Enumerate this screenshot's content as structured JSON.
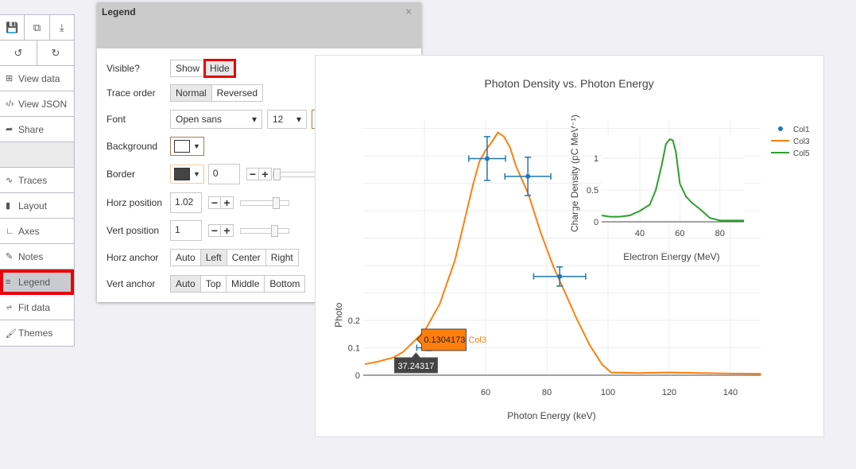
{
  "sidebar": {
    "toolbar_top": [
      {
        "icon": "save-icon",
        "glyph": "💾"
      },
      {
        "icon": "copy-icon",
        "glyph": "⧉"
      },
      {
        "icon": "download-icon",
        "glyph": "⤓"
      }
    ],
    "toolbar_undo": [
      {
        "icon": "undo-icon",
        "glyph": "↺"
      },
      {
        "icon": "redo-icon",
        "glyph": "↻"
      }
    ],
    "items": [
      {
        "label": "View data",
        "icon": "grid-icon",
        "glyph": "⊞"
      },
      {
        "label": "View JSON",
        "icon": "code-icon",
        "glyph": "‹/›"
      },
      {
        "label": "Share",
        "icon": "share-icon",
        "glyph": "➦"
      },
      {
        "label": "",
        "icon": "",
        "glyph": ""
      },
      {
        "label": "Traces",
        "icon": "traces-icon",
        "glyph": "∿"
      },
      {
        "label": "Layout",
        "icon": "layout-icon",
        "glyph": "▮"
      },
      {
        "label": "Axes",
        "icon": "axes-icon",
        "glyph": "∟"
      },
      {
        "label": "Notes",
        "icon": "notes-icon",
        "glyph": "✎"
      },
      {
        "label": "Legend",
        "icon": "legend-icon",
        "glyph": "≡",
        "active": true
      },
      {
        "label": "Fit data",
        "icon": "fit-icon",
        "glyph": "⩫"
      },
      {
        "label": "Themes",
        "icon": "themes-icon",
        "glyph": "🖌"
      }
    ]
  },
  "panel": {
    "title": "Legend",
    "close": "×",
    "visible": {
      "label": "Visible?",
      "options": [
        "Show",
        "Hide"
      ],
      "selected": "Hide"
    },
    "trace_order": {
      "label": "Trace order",
      "options": [
        "Normal",
        "Reversed"
      ],
      "selected": "Normal"
    },
    "font": {
      "label": "Font",
      "family": "Open sans",
      "size": "12",
      "color": "#444444"
    },
    "background": {
      "label": "Background",
      "color": "#ffffff"
    },
    "border": {
      "label": "Border",
      "color": "#444444",
      "width": "0",
      "slider": 0
    },
    "horz_position": {
      "label": "Horz position",
      "value": "1.02",
      "slider": 0.78
    },
    "vert_position": {
      "label": "Vert position",
      "value": "1",
      "slider": 0.75
    },
    "horz_anchor": {
      "label": "Horz anchor",
      "options": [
        "Auto",
        "Left",
        "Center",
        "Right"
      ],
      "selected": "Left"
    },
    "vert_anchor": {
      "label": "Vert anchor",
      "options": [
        "Auto",
        "Top",
        "Middle",
        "Bottom"
      ],
      "selected": "Auto"
    }
  },
  "chart_data": {
    "type": "line",
    "title": "Photon Density vs. Photon Energy",
    "xlabel": "Photon Energy (keV)",
    "ylabel": "Photo",
    "xlim": [
      20,
      150
    ],
    "ylim": [
      0,
      0.93
    ],
    "xticks": [
      60,
      80,
      100,
      120,
      140
    ],
    "yticks": [
      0,
      0.1,
      0.2
    ],
    "grid": true,
    "legend": "top-right",
    "colors": {
      "Col1": "#1f77b4",
      "Col3": "#ff7f0e",
      "Col5": "#2ca02c"
    },
    "series": [
      {
        "name": "Col1",
        "mode": "markers",
        "points": [
          [
            41.5,
            0.1,
            4,
            0.01
          ],
          [
            60.5,
            0.79,
            6,
            0.08
          ],
          [
            73.8,
            0.725,
            7.5,
            0.07
          ],
          [
            84.2,
            0.36,
            8.5,
            0.035
          ]
        ]
      },
      {
        "name": "Col3",
        "mode": "lines",
        "points": [
          [
            20.5,
            0.04
          ],
          [
            25,
            0.05
          ],
          [
            30,
            0.065
          ],
          [
            33,
            0.085
          ],
          [
            37.2,
            0.13
          ],
          [
            40,
            0.16
          ],
          [
            45,
            0.26
          ],
          [
            50,
            0.42
          ],
          [
            53,
            0.56
          ],
          [
            56,
            0.7
          ],
          [
            58,
            0.78
          ],
          [
            60,
            0.82
          ],
          [
            62,
            0.85
          ],
          [
            64,
            0.885
          ],
          [
            66,
            0.87
          ],
          [
            68,
            0.83
          ],
          [
            70,
            0.76
          ],
          [
            74,
            0.66
          ],
          [
            78,
            0.52
          ],
          [
            82,
            0.4
          ],
          [
            86,
            0.3
          ],
          [
            90,
            0.2
          ],
          [
            94,
            0.11
          ],
          [
            98,
            0.04
          ],
          [
            101,
            0.01
          ],
          [
            110,
            0.008
          ],
          [
            120,
            0.01
          ],
          [
            130,
            0.008
          ],
          [
            140,
            0.006
          ],
          [
            150,
            0.005
          ]
        ]
      }
    ],
    "inset": {
      "xlabel": "Electron Energy (MeV)",
      "ylabel": "Charge Density (pC MeV⁻¹)",
      "xlim": [
        21,
        92
      ],
      "ylim": [
        0,
        1.35
      ],
      "xticks": [
        40,
        60,
        80
      ],
      "yticks": [
        0,
        0.5,
        1
      ],
      "series": [
        {
          "name": "Col5",
          "points": [
            [
              21,
              0.1
            ],
            [
              25,
              0.08
            ],
            [
              30,
              0.08
            ],
            [
              35,
              0.1
            ],
            [
              40,
              0.17
            ],
            [
              45,
              0.27
            ],
            [
              48,
              0.5
            ],
            [
              51,
              0.9
            ],
            [
              53,
              1.22
            ],
            [
              55,
              1.3
            ],
            [
              56.5,
              1.28
            ],
            [
              58,
              1.1
            ],
            [
              60,
              0.6
            ],
            [
              63,
              0.4
            ],
            [
              66,
              0.3
            ],
            [
              70,
              0.2
            ],
            [
              75,
              0.06
            ],
            [
              80,
              0.02
            ],
            [
              92,
              0.02
            ]
          ]
        }
      ]
    },
    "hover": {
      "x_label": "37.24317",
      "y_label": "0.1304173",
      "trace": "Col3",
      "x": 37.24317,
      "y": 0.1304173
    }
  }
}
